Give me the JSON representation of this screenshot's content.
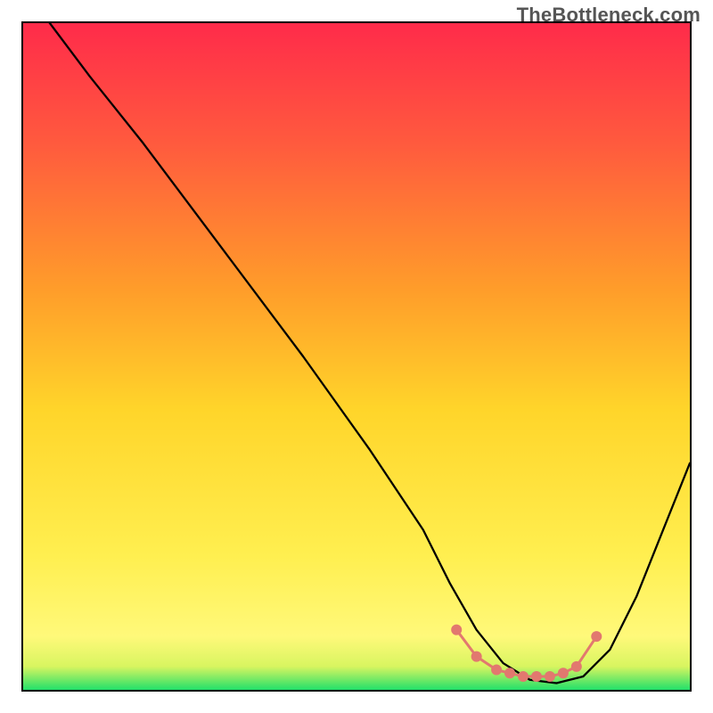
{
  "watermark": "TheBottleneck.com",
  "chart_data": {
    "type": "line",
    "title": "",
    "xlabel": "",
    "ylabel": "",
    "xlim": [
      0,
      100
    ],
    "ylim": [
      0,
      100
    ],
    "grid": false,
    "legend": false,
    "background_gradient": {
      "top_color": "#ff2b4a",
      "mid_color": "#ffd52a",
      "near_bottom_color": "#fff97a",
      "bottom_color": "#22e06a"
    },
    "curve": {
      "x": [
        0,
        4,
        10,
        18,
        30,
        42,
        52,
        60,
        64,
        68,
        72,
        76,
        80,
        84,
        88,
        92,
        96,
        100
      ],
      "y": [
        105,
        100,
        92,
        82,
        66,
        50,
        36,
        24,
        16,
        9,
        4,
        1.5,
        1,
        2,
        6,
        14,
        24,
        34
      ]
    },
    "markers": {
      "color": "#e2786f",
      "marker_radius": 6,
      "line_color": "#e2786f",
      "line_width": 3,
      "points": [
        {
          "x": 65,
          "y": 9
        },
        {
          "x": 68,
          "y": 5
        },
        {
          "x": 71,
          "y": 3
        },
        {
          "x": 73,
          "y": 2.5
        },
        {
          "x": 75,
          "y": 2
        },
        {
          "x": 77,
          "y": 2
        },
        {
          "x": 79,
          "y": 2
        },
        {
          "x": 81,
          "y": 2.5
        },
        {
          "x": 83,
          "y": 3.5
        },
        {
          "x": 86,
          "y": 8
        }
      ]
    }
  }
}
